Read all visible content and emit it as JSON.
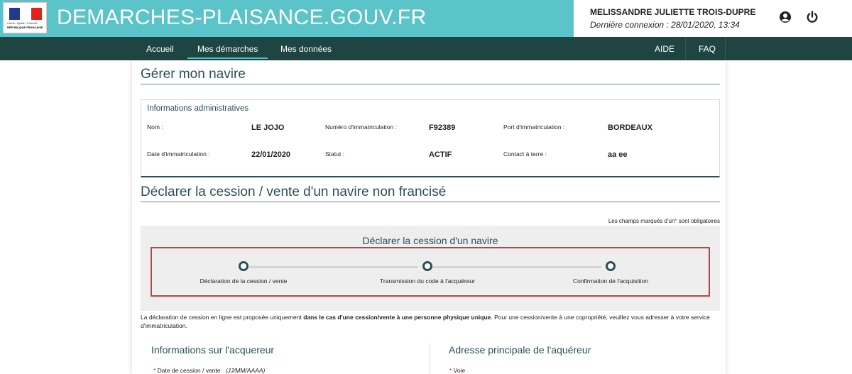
{
  "header": {
    "logo": {
      "motto": "Liberté • Égalité • Fraternité",
      "country": "RÉPUBLIQUE FRANÇAISE"
    },
    "site_title": "DEMARCHES-PLAISANCE.GOUV.FR",
    "user_name": "MELISSANDRE JULIETTE TROIS-DUPRE",
    "last_login": "Dernière connexion : 28/01/2020, 13:34",
    "icons": [
      "user-icon",
      "power-icon"
    ]
  },
  "nav": {
    "items": [
      {
        "label": "Accueil"
      },
      {
        "label": "Mes démarches",
        "active": true
      },
      {
        "label": "Mes données"
      }
    ],
    "right_items": [
      {
        "label": "AIDE"
      },
      {
        "label": "FAQ"
      }
    ]
  },
  "page": {
    "title": "Gérer mon navire",
    "admin_info": {
      "title": "Informations administratives",
      "fields": [
        {
          "label": "Nom :",
          "value": "LE JOJO"
        },
        {
          "label": "Numéro d'immatriculation :",
          "value": "F92389"
        },
        {
          "label": "Port d'immatriculation :",
          "value": "BORDEAUX"
        },
        {
          "label": "Date d'immatriculation :",
          "value": "22/01/2020"
        },
        {
          "label": "Statut :",
          "value": "ACTIF"
        },
        {
          "label": "Contact à terre :",
          "value": "aa ee"
        }
      ]
    },
    "section_title": "Déclarer la cession / vente d'un navire non francisé",
    "mandatory_note": {
      "before": "Les champs marqués d'un",
      "star": "*",
      "after": " sont obligatoires"
    },
    "steps": {
      "title": "Déclarer la cession d'un navire",
      "items": [
        {
          "label": "Déclaration de la cession / vente"
        },
        {
          "label": "Transmission du code à l'acquéreur"
        },
        {
          "label": "Confirmation de l'acquisition"
        }
      ]
    },
    "notice": {
      "part1": "La déclaration de cession en ligne est proposée uniquement ",
      "bold": "dans le cas d'une cession/vente à une personne physique unique",
      "part2": ". Pour une cession/vente à une copropriété, veuillez vous adresser à votre service d'immatriculation."
    },
    "left_section": {
      "title": "Informations sur l'acquereur",
      "field_label": "Date de cession / vente",
      "field_hint": "(JJ/MM/AAAA)"
    },
    "right_section": {
      "title": "Adresse principale de l'aquéreur",
      "field_label": "Voie"
    }
  },
  "colors": {
    "header_teal": "#5bc4c8",
    "nav_dark": "#1f4543",
    "heading": "#2c4f55",
    "highlight_red": "#d43a3a",
    "required_star": "#d62c2c"
  }
}
